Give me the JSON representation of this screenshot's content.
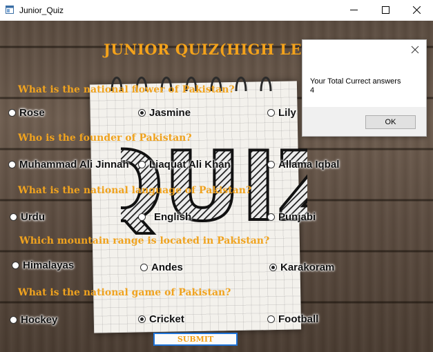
{
  "window": {
    "title": "Junior_Quiz",
    "icon": "app-form-icon",
    "controls": [
      "minimize-icon",
      "maximize-icon",
      "close-icon"
    ]
  },
  "quiz": {
    "heading": "JUNIOR QUIZ(HIGH LEV",
    "questions": [
      {
        "text": "What is the national flower of Pakistan?",
        "options": [
          {
            "label": "Rose",
            "checked": false
          },
          {
            "label": "Jasmine",
            "checked": true
          },
          {
            "label": "Lily",
            "checked": false
          }
        ]
      },
      {
        "text": "Who is the founder of Pakistan?",
        "options": [
          {
            "label": "Muhammad Ali Jinnah",
            "checked": false
          },
          {
            "label": "Liaquat Ali Khan",
            "checked": false
          },
          {
            "label": "Allama Iqbal",
            "checked": false
          }
        ]
      },
      {
        "text": "What is the national language of Pakistan?",
        "options": [
          {
            "label": "Urdu",
            "checked": false
          },
          {
            "label": "English",
            "checked": false
          },
          {
            "label": "Punjabi",
            "checked": false
          }
        ]
      },
      {
        "text": "Which mountain range is located in Pakistan?",
        "options": [
          {
            "label": "Himalayas",
            "checked": false
          },
          {
            "label": "Andes",
            "checked": false
          },
          {
            "label": "Karakoram",
            "checked": true
          }
        ]
      },
      {
        "text": "What is the national game of Pakistan?",
        "options": [
          {
            "label": "Hockey",
            "checked": false
          },
          {
            "label": "Cricket",
            "checked": true
          },
          {
            "label": "Football",
            "checked": false
          }
        ]
      }
    ],
    "submit_label": "SUBMIT",
    "background_text": "QUIZ"
  },
  "message_box": {
    "line1": "Your Total Currect answers",
    "line2": "4",
    "ok_label": "OK"
  },
  "colors": {
    "question": "#f0a31f",
    "heading": "#f3a21b",
    "submit_border": "#1e73d8"
  }
}
